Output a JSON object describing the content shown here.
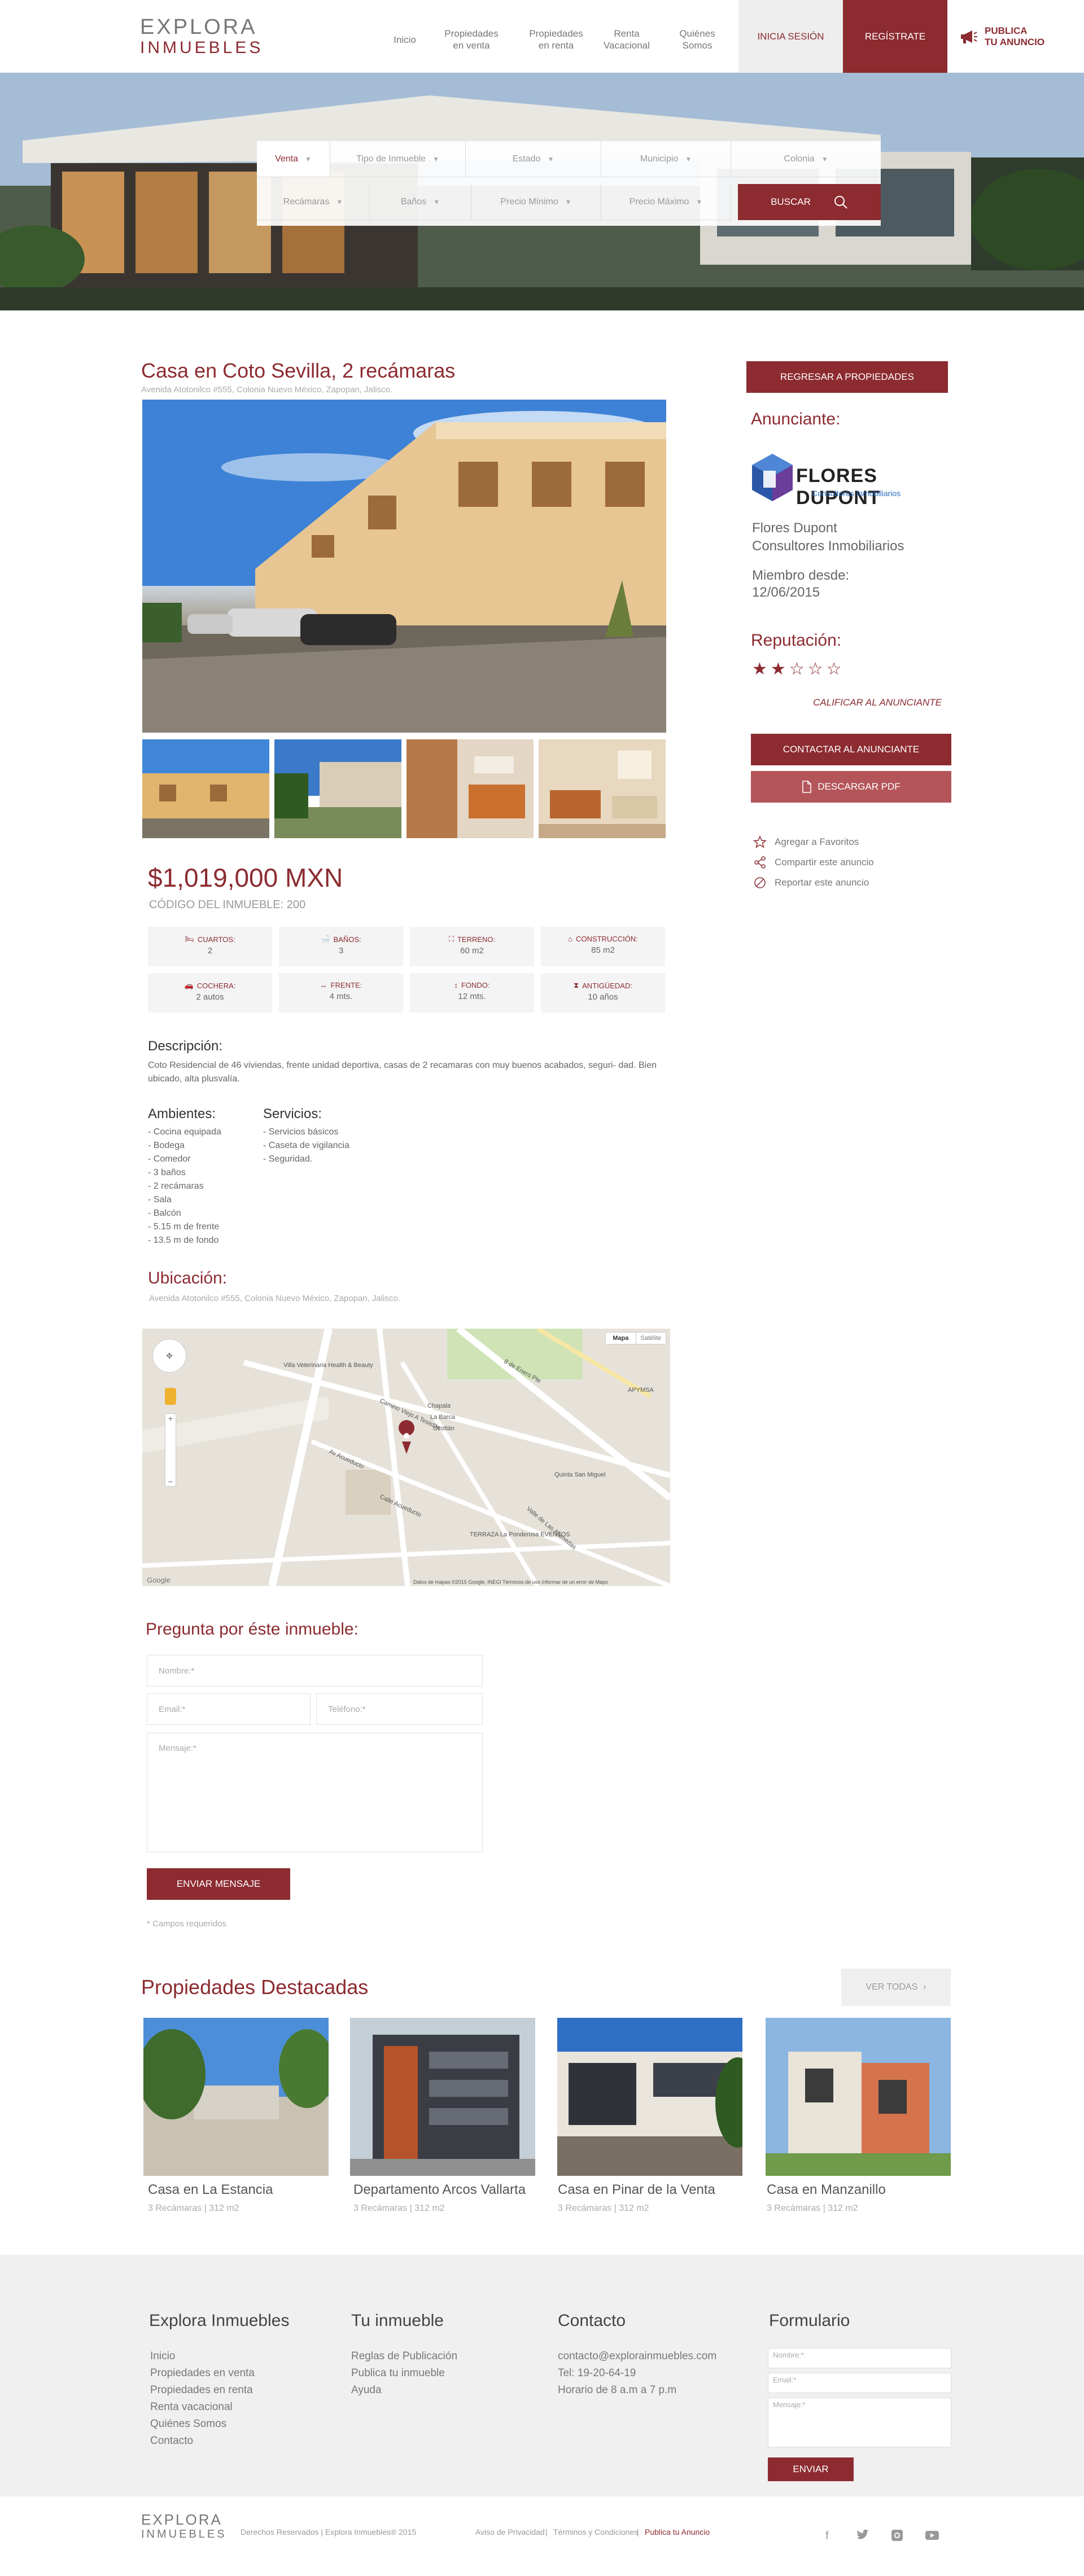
{
  "header": {
    "logo_top": "EXPLORA",
    "logo_bottom": "INMUEBLES",
    "nav": [
      {
        "label_1": "Inicio",
        "label_2": ""
      },
      {
        "label_1": "Propiedades",
        "label_2": "en venta"
      },
      {
        "label_1": "Propiedades",
        "label_2": "en renta"
      },
      {
        "label_1": "Renta",
        "label_2": "Vacacional"
      },
      {
        "label_1": "Quiénes",
        "label_2": "Somos"
      }
    ],
    "login": "INICIA SESIÓN",
    "register": "REGÍSTRATE",
    "publish_1": "PUBLICA",
    "publish_2": "TU ANUNCIO"
  },
  "search": {
    "operation": "Venta",
    "type": "Tipo de Inmueble",
    "state": "Estado",
    "municipality": "Municipio",
    "neighborhood": "Colonia",
    "bedrooms": "Recámaras",
    "bathrooms": "Baños",
    "min_price": "Precio Mínimo",
    "max_price": "Precio Máximo",
    "button": "BUSCAR"
  },
  "property": {
    "title": "Casa en Coto Sevilla, 2 recámaras",
    "address": "Avenida Atotonilco #555, Colonia Nuevo México, Zapopan, Jalisco.",
    "price": "$1,019,000 MXN",
    "code": "CÓDIGO DEL INMUEBLE: 200",
    "features": [
      {
        "label": "CUARTOS:",
        "value": "2",
        "icon": "bed-icon"
      },
      {
        "label": "BAÑOS:",
        "value": "3",
        "icon": "bath-icon"
      },
      {
        "label": "TERRENO:",
        "value": "60 m2",
        "icon": "land-icon"
      },
      {
        "label": "CONSTRUCCIÓN:",
        "value": "85 m2",
        "icon": "house-icon"
      },
      {
        "label": "COCHERA:",
        "value": "2 autos",
        "icon": "car-icon"
      },
      {
        "label": "FRENTE:",
        "value": "4 mts.",
        "icon": "width-icon"
      },
      {
        "label": "FONDO:",
        "value": "12 mts.",
        "icon": "depth-icon"
      },
      {
        "label": "ANTIGÜEDAD:",
        "value": "10 años",
        "icon": "hourglass-icon"
      }
    ],
    "description_title": "Descripción:",
    "description": "Coto Residencial de 46 viviendas, frente unidad deportiva, casas de 2 recamaras con muy buenos acabados, seguri- dad. Bien ubicado, alta plusvalía.",
    "ambientes_title": "Ambientes:",
    "ambientes": [
      "- Cocina equipada",
      "- Bodega",
      "- Comedor",
      "- 3 baños",
      "- 2 recámaras",
      "- Sala",
      "- Balcón",
      "- 5.15 m de frente",
      "- 13.5 m de fondo"
    ],
    "servicios_title": "Servicios:",
    "servicios": [
      "- Servicios básicos",
      "- Caseta de vigilancia",
      "- Seguridad."
    ],
    "location_title": "Ubicación:",
    "location_address": "Avenida Atotonilco #555, Colonia Nuevo México, Zapopan, Jalisco."
  },
  "map": {
    "type_map": "Mapa",
    "type_sat": "Satélite",
    "labels": [
      "Villa Veterinaria Health & Beauty",
      "Camino Viejo A Tesistán",
      "8 de Enero Pte",
      "Av Acueducto",
      "Calle Acueducto",
      "Quinta San Miguel",
      "Valle de Las Alamedas",
      "TERRAZA La Ponderosa EVENTOS",
      "Chapala",
      "La Barca",
      "Ocotlán",
      "APYMSA"
    ],
    "credits": "Datos de mapas ©2015 Google, INEGI   Términos de uso   Informar de un error de Maps",
    "google": "Google"
  },
  "sidebar": {
    "back": "REGRESAR A PROPIEDADES",
    "advertiser_title": "Anunciante:",
    "adv_logo_main": "FLORES DUPONT",
    "adv_logo_sub": "Consultores Inmobiliarios",
    "adv_name_1": "Flores Dupont",
    "adv_name_2": "Consultores Inmobiliarios",
    "member_label": "Miembro desde:",
    "member_date": "12/06/2015",
    "reputation_title": "Reputación:",
    "rating": 2,
    "rate_link": "CALIFICAR AL ANUNCIANTE",
    "contact": "CONTACTAR AL ANUNCIANTE",
    "pdf": "DESCARGAR PDF",
    "favorite": "Agregar a Favoritos",
    "share": "Compartir este anuncio",
    "report": "Reportar este anuncio"
  },
  "form": {
    "title": "Pregunta por éste inmueble:",
    "name": "Nombre:*",
    "email": "Email:*",
    "phone": "Teléfono:*",
    "message": "Mensaje:*",
    "send": "ENVIAR MENSAJE",
    "required": "* Campos requeridos"
  },
  "featured": {
    "title": "Propiedades Destacadas",
    "view_all": "VER TODAS",
    "cards": [
      {
        "title": "Casa en La Estancia",
        "sub": "3 Recámaras | 312 m2"
      },
      {
        "title": "Departamento Arcos Vallarta",
        "sub": "3 Recámaras | 312 m2"
      },
      {
        "title": "Casa en Pinar de la Venta",
        "sub": "3 Recámaras | 312 m2"
      },
      {
        "title": "Casa en Manzanillo",
        "sub": "3 Recámaras | 312 m2"
      }
    ]
  },
  "footer": {
    "col1_title": "Explora Inmuebles",
    "col1_links": [
      "Inicio",
      "Propiedades en venta",
      "Propiedades en renta",
      "Renta vacacional",
      "Quiénes Somos",
      "Contacto"
    ],
    "col2_title": "Tu inmueble",
    "col2_links": [
      "Reglas de Publicación",
      "Publica tu inmueble",
      "Ayuda"
    ],
    "col3_title": "Contacto",
    "col3_lines": [
      "contacto@explorainmuebles.com",
      "Tel: 19-20-64-19",
      "Horario de 8 a.m a 7 p.m"
    ],
    "col4_title": "Formulario",
    "form_name": "Nombre:*",
    "form_email": "Email:*",
    "form_message": "Mensaje:*",
    "form_send": "ENVIAR",
    "rights": "Derechos Reservados  |  Explora Inmuebles® 2015",
    "privacy": "Aviso de Privacidad",
    "terms": "Términos y Condiciones",
    "publish": "Publica tu Anuncio",
    "social": [
      "facebook-icon",
      "twitter-icon",
      "instagram-icon",
      "youtube-icon"
    ]
  },
  "colors": {
    "accent": "#8c2b30",
    "accent_light": "#b4555a",
    "panel": "#f0f0f0"
  }
}
